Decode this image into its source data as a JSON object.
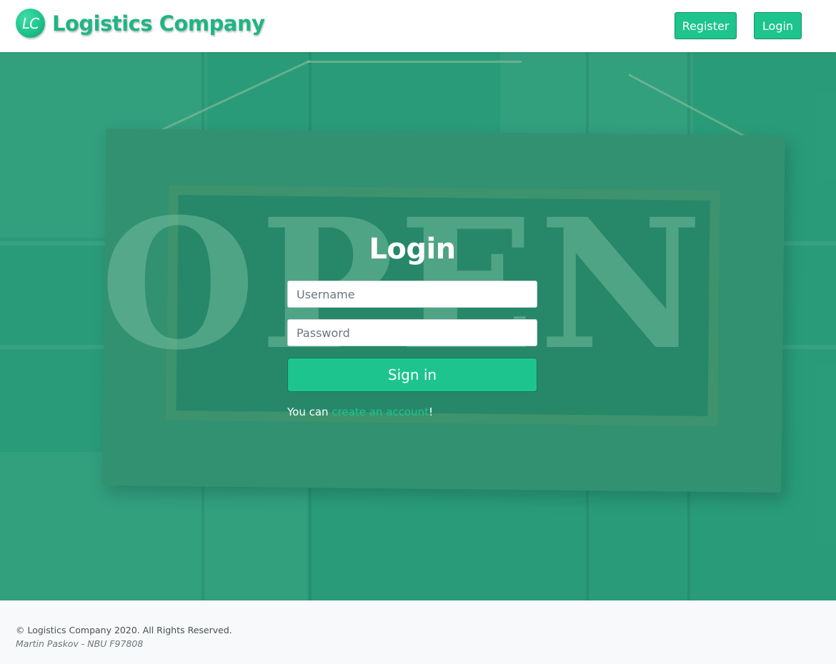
{
  "header": {
    "logo_text": "LC",
    "brand_name": "Logistics Company",
    "nav": {
      "register_label": "Register",
      "login_label": "Login"
    }
  },
  "hero": {
    "sign_text": "OPEN"
  },
  "login_form": {
    "title": "Login",
    "username_placeholder": "Username",
    "password_placeholder": "Password",
    "submit_label": "Sign in",
    "helper_prefix": "You can ",
    "helper_link": "create an account",
    "helper_suffix": "!"
  },
  "footer": {
    "copyright": "© Logistics Company 2020. All Rights Reserved.",
    "author": "Martin Paskov - NBU F97808"
  },
  "colors": {
    "accent": "#1ec48d",
    "hero_bg": "#2f9a79",
    "header_bg": "#ffffff",
    "footer_bg": "#f8f9fa"
  }
}
